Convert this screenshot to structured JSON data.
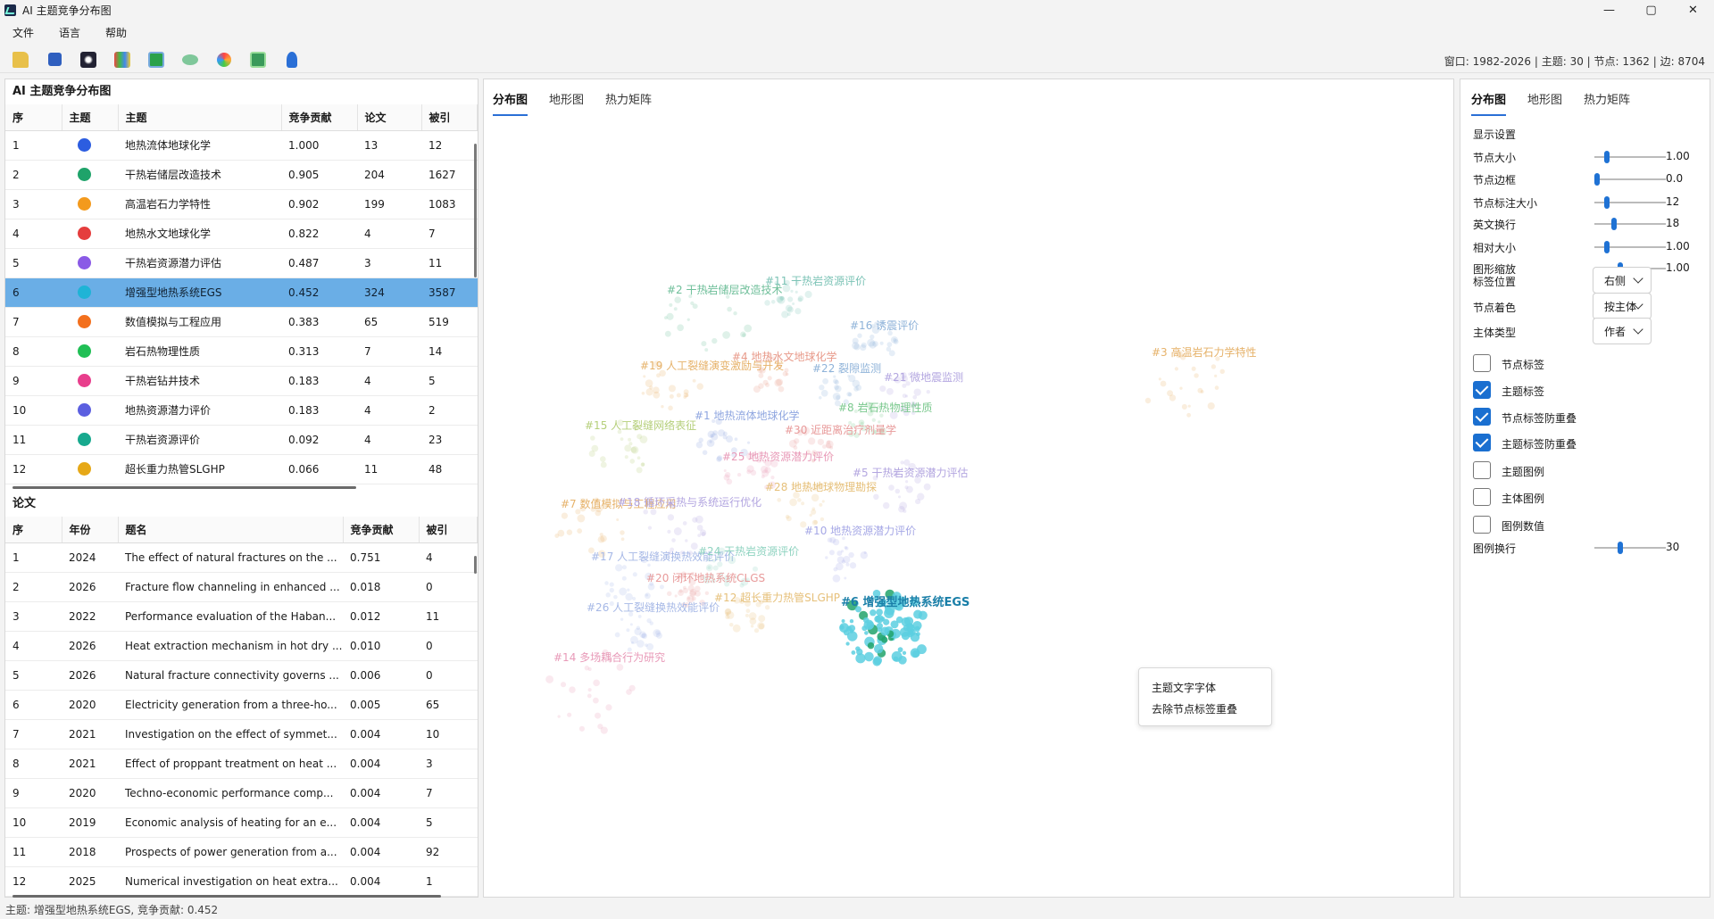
{
  "window": {
    "title": "AI 主题竞争分布图",
    "controls": [
      "—",
      "▢",
      "✕"
    ]
  },
  "menu": [
    "文件",
    "语言",
    "帮助"
  ],
  "toolbar": {
    "info": "窗口: 1982-2026 | 主题: 30 | 节点: 1362 | 边: 8704",
    "icons": [
      "folder-open-icon",
      "save-icon",
      "dark-theme-icon",
      "palette-icon",
      "export-image-icon",
      "shape-icon",
      "color-wheel-icon",
      "layout-icon",
      "person-icon"
    ]
  },
  "topics": {
    "title": "AI 主题竞争分布图",
    "columns": [
      "序",
      "主题",
      "主题",
      "竞争贡献",
      "论文",
      "被引"
    ],
    "rows": [
      {
        "idx": "1",
        "color": "#2c5de0",
        "name": "地热流体地球化学",
        "contrib": "1.000",
        "papers": "13",
        "cites": "12"
      },
      {
        "idx": "2",
        "color": "#1fa36a",
        "name": "干热岩储层改造技术",
        "contrib": "0.905",
        "papers": "204",
        "cites": "1627"
      },
      {
        "idx": "3",
        "color": "#f39a1d",
        "name": "高温岩石力学特性",
        "contrib": "0.902",
        "papers": "199",
        "cites": "1083"
      },
      {
        "idx": "4",
        "color": "#e53d3d",
        "name": "地热水文地球化学",
        "contrib": "0.822",
        "papers": "4",
        "cites": "7"
      },
      {
        "idx": "5",
        "color": "#8a5ae6",
        "name": "干热岩资源潜力评估",
        "contrib": "0.487",
        "papers": "3",
        "cites": "11"
      },
      {
        "idx": "6",
        "color": "#1fb4d6",
        "name": "增强型地热系统EGS",
        "contrib": "0.452",
        "papers": "324",
        "cites": "3587"
      },
      {
        "idx": "7",
        "color": "#f3701d",
        "name": "数值模拟与工程应用",
        "contrib": "0.383",
        "papers": "65",
        "cites": "519"
      },
      {
        "idx": "8",
        "color": "#20bf55",
        "name": "岩石热物理性质",
        "contrib": "0.313",
        "papers": "7",
        "cites": "14"
      },
      {
        "idx": "9",
        "color": "#e83e8c",
        "name": "干热岩钻井技术",
        "contrib": "0.183",
        "papers": "4",
        "cites": "5"
      },
      {
        "idx": "10",
        "color": "#5b5fe0",
        "name": "地热资源潜力评价",
        "contrib": "0.183",
        "papers": "4",
        "cites": "2"
      },
      {
        "idx": "11",
        "color": "#17a98e",
        "name": "干热岩资源评价",
        "contrib": "0.092",
        "papers": "4",
        "cites": "23"
      },
      {
        "idx": "12",
        "color": "#e6a817",
        "name": "超长重力热管SLGHP",
        "contrib": "0.066",
        "papers": "11",
        "cites": "48"
      }
    ]
  },
  "papers": {
    "title": "论文",
    "columns": [
      "序",
      "年份",
      "题名",
      "竞争贡献",
      "被引"
    ],
    "rows": [
      {
        "idx": "1",
        "year": "2024",
        "title": "The effect of natural fractures on the ...",
        "contrib": "0.751",
        "cites": "4"
      },
      {
        "idx": "2",
        "year": "2026",
        "title": "Fracture flow channeling in enhanced ...",
        "contrib": "0.018",
        "cites": "0"
      },
      {
        "idx": "3",
        "year": "2022",
        "title": "Performance evaluation of the Haban...",
        "contrib": "0.012",
        "cites": "11"
      },
      {
        "idx": "4",
        "year": "2026",
        "title": "Heat extraction mechanism in hot dry ...",
        "contrib": "0.010",
        "cites": "0"
      },
      {
        "idx": "5",
        "year": "2026",
        "title": "Natural fracture connectivity governs ...",
        "contrib": "0.006",
        "cites": "0"
      },
      {
        "idx": "6",
        "year": "2020",
        "title": "Electricity generation from a three-ho...",
        "contrib": "0.005",
        "cites": "65"
      },
      {
        "idx": "7",
        "year": "2021",
        "title": "Investigation on the effect of symmet...",
        "contrib": "0.004",
        "cites": "10"
      },
      {
        "idx": "8",
        "year": "2021",
        "title": "Effect of proppant treatment on heat ...",
        "contrib": "0.004",
        "cites": "3"
      },
      {
        "idx": "9",
        "year": "2020",
        "title": "Techno-economic performance comp...",
        "contrib": "0.004",
        "cites": "7"
      },
      {
        "idx": "10",
        "year": "2019",
        "title": "Economic analysis of heating for an e...",
        "contrib": "0.004",
        "cites": "5"
      },
      {
        "idx": "11",
        "year": "2018",
        "title": "Prospects of power generation from a...",
        "contrib": "0.004",
        "cites": "92"
      },
      {
        "idx": "12",
        "year": "2025",
        "title": "Numerical investigation on heat extra...",
        "contrib": "0.004",
        "cites": "1"
      }
    ]
  },
  "center": {
    "tabs": [
      "分布图",
      "地形图",
      "热力矩阵"
    ],
    "active_tab": "分布图",
    "context_menu": [
      "主题文字字体",
      "去除节点标签重叠"
    ],
    "labels": [
      {
        "text": "#2 干热岩储层改造技术",
        "color": "#6fbf9a"
      },
      {
        "text": "#11 干热岩资源评价",
        "color": "#7cc3b6"
      },
      {
        "text": "#16 诱震评价",
        "color": "#8fb3d9"
      },
      {
        "text": "#3 高温岩石力学特性",
        "color": "#e6b26a"
      },
      {
        "text": "#4 地热水文地球化学",
        "color": "#e89a8a"
      },
      {
        "text": "#19 人工裂缝演变激励与开发",
        "color": "#e6b26a"
      },
      {
        "text": "#22 裂隙监测",
        "color": "#8fb3d9"
      },
      {
        "text": "#21 微地震监测",
        "color": "#b3a6e0"
      },
      {
        "text": "#8 岩石热物理性质",
        "color": "#7cc98f"
      },
      {
        "text": "#15 人工裂缝网络表征",
        "color": "#b5cf7a"
      },
      {
        "text": "#1 地热流体地球化学",
        "color": "#8fa6e0"
      },
      {
        "text": "#30 近距离治疗剂量学",
        "color": "#e89a9a"
      },
      {
        "text": "#25 地热资源潜力评价",
        "color": "#e89ab8"
      },
      {
        "text": "#5 干热岩资源潜力评估",
        "color": "#b3a6e0"
      },
      {
        "text": "#28 地热地球物理勘探",
        "color": "#e6c07a"
      },
      {
        "text": "#7 数值模拟与工程应用",
        "color": "#e6b26a"
      },
      {
        "text": "#18 循环采热与系统运行优化",
        "color": "#b3a6e0"
      },
      {
        "text": "#10 地热资源潜力评价",
        "color": "#a6a8e6"
      },
      {
        "text": "#17 人工裂缝演换热效能评价",
        "color": "#a6b8e6"
      },
      {
        "text": "#24 干热岩资源评价",
        "color": "#8fd3c0"
      },
      {
        "text": "#20 闭环地热系统CLGS",
        "color": "#e89a9a"
      },
      {
        "text": "#12 超长重力热管SLGHP",
        "color": "#e6c07a"
      },
      {
        "text": "#6 增强型地热系统EGS",
        "color": "#1a7fa8"
      },
      {
        "text": "#26 人工裂缝换热效能评价",
        "color": "#a6b8e6"
      },
      {
        "text": "#14 多场耦合行为研究",
        "color": "#e89ab8"
      }
    ]
  },
  "right": {
    "tabs": [
      "分布图",
      "地形图",
      "热力矩阵"
    ],
    "active_tab": "分布图",
    "section": "显示设置",
    "sliders": [
      {
        "label": "节点大小",
        "value": "1.00",
        "pos": 0.15
      },
      {
        "label": "节点边框",
        "value": "0.0",
        "pos": 0.0
      },
      {
        "label": "节点标注大小",
        "value": "12",
        "pos": 0.15
      },
      {
        "label": "英文换行",
        "value": "18",
        "pos": 0.25
      },
      {
        "label": "相对大小",
        "value": "1.00",
        "pos": 0.15
      },
      {
        "label": "图形缩放",
        "value": "1.00",
        "pos": 0.35
      }
    ],
    "combos": [
      {
        "label": "标签位置",
        "value": "右侧"
      },
      {
        "label": "节点着色",
        "value": "按主体"
      },
      {
        "label": "主体类型",
        "value": "作者"
      }
    ],
    "checkboxes": [
      {
        "label": "节点标签",
        "checked": false
      },
      {
        "label": "主题标签",
        "checked": true
      },
      {
        "label": "节点标签防重叠",
        "checked": true
      },
      {
        "label": "主题标签防重叠",
        "checked": true
      },
      {
        "label": "主题图例",
        "checked": false
      },
      {
        "label": "主体图例",
        "checked": false
      },
      {
        "label": "图例数值",
        "checked": false
      }
    ],
    "legend_wrap": {
      "label": "图例换行",
      "value": "30",
      "pos": 0.35
    }
  },
  "status": "主题: 增强型地热系统EGS, 竞争贡献: 0.452"
}
